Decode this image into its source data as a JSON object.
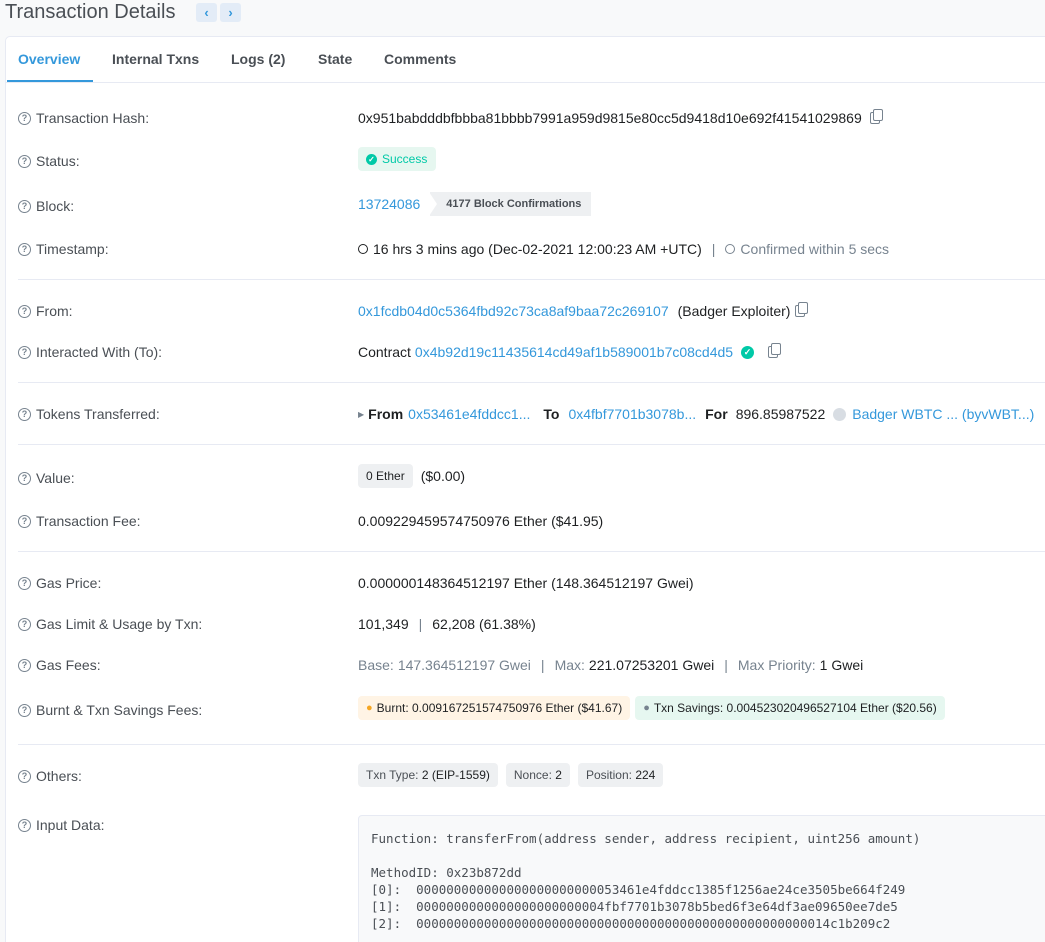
{
  "title": "Transaction Details",
  "tabs": [
    {
      "label": "Overview"
    },
    {
      "label": "Internal Txns"
    },
    {
      "label": "Logs (2)"
    },
    {
      "label": "State"
    },
    {
      "label": "Comments"
    }
  ],
  "rows": {
    "hash": {
      "label": "Transaction Hash:",
      "value": "0x951babdddbfbbba81bbbb7991a959d9815e80cc5d9418d10e692f41541029869"
    },
    "status": {
      "label": "Status:",
      "value": "Success"
    },
    "block": {
      "label": "Block:",
      "value": "13724086",
      "confirmations": "4177 Block Confirmations"
    },
    "timestamp": {
      "label": "Timestamp:",
      "value": "16 hrs 3 mins ago (Dec-02-2021 12:00:23 AM +UTC)",
      "confirmed": "Confirmed within 5 secs"
    },
    "from": {
      "label": "From:",
      "address": "0x1fcdb04d0c5364fbd92c73ca8af9baa72c269107",
      "name": "(Badger Exploiter)"
    },
    "to": {
      "label": "Interacted With (To):",
      "prefix": "Contract",
      "address": "0x4b92d19c11435614cd49af1b589001b7c08cd4d5"
    },
    "tokens": {
      "label": "Tokens Transferred:",
      "from_label": "From",
      "from_addr": "0x53461e4fddcc1...",
      "to_label": "To",
      "to_addr": "0x4fbf7701b3078b...",
      "for_label": "For",
      "amount": "896.85987522",
      "token": "Badger WBTC ... (byvWBT...)"
    },
    "value": {
      "label": "Value:",
      "amount": "0 Ether",
      "usd": "($0.00)"
    },
    "fee": {
      "label": "Transaction Fee:",
      "value": "0.009229459574750976 Ether ($41.95)"
    },
    "gas_price": {
      "label": "Gas Price:",
      "value": "0.000000148364512197 Ether (148.364512197 Gwei)"
    },
    "gas_limit": {
      "label": "Gas Limit & Usage by Txn:",
      "limit": "101,349",
      "usage": "62,208 (61.38%)"
    },
    "gas_fees": {
      "label": "Gas Fees:",
      "base_label": "Base:",
      "base": "147.364512197 Gwei",
      "max_label": "Max:",
      "max": "221.07253201 Gwei",
      "priority_label": "Max Priority:",
      "priority": "1 Gwei"
    },
    "burnt": {
      "label": "Burnt & Txn Savings Fees:",
      "burnt": "Burnt: 0.009167251574750976 Ether ($41.67)",
      "savings": "Txn Savings: 0.004523020496527104 Ether ($20.56)"
    },
    "others": {
      "label": "Others:",
      "type_label": "Txn Type:",
      "type": "2 (EIP-1559)",
      "nonce_label": "Nonce:",
      "nonce": "2",
      "position_label": "Position:",
      "position": "224"
    },
    "input": {
      "label": "Input Data:",
      "text": "Function: transferFrom(address sender, address recipient, uint256 amount)\n\nMethodID: 0x23b872dd\n[0]:  000000000000000000000000053461e4fddcc1385f1256ae24ce3505be664f249\n[1]:  0000000000000000000000004fbf7701b3078b5bed6f3e64df3ae09650ee7de5\n[2]:  0000000000000000000000000000000000000000000000000000014c1b209c2"
    }
  }
}
